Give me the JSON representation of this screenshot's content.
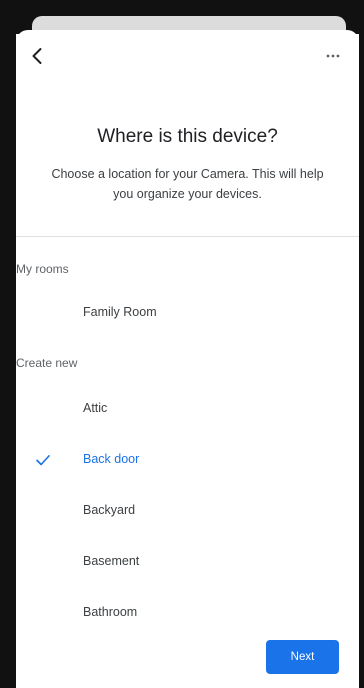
{
  "header": {
    "back_icon": "arrow-back-icon",
    "more_icon": "more-horizontal-icon",
    "more_label": "..."
  },
  "title": "Where is this device?",
  "subtitle": "Choose a location for your Camera. This will help you organize your devices.",
  "sections": {
    "my_rooms": {
      "label": "My rooms",
      "items": [
        {
          "label": "Family Room",
          "selected": false
        }
      ]
    },
    "create_new": {
      "label": "Create new",
      "items": [
        {
          "label": "Attic",
          "selected": false
        },
        {
          "label": "Back door",
          "selected": true
        },
        {
          "label": "Backyard",
          "selected": false
        },
        {
          "label": "Basement",
          "selected": false
        },
        {
          "label": "Bathroom",
          "selected": false
        }
      ]
    }
  },
  "footer": {
    "next_label": "Next"
  },
  "colors": {
    "accent": "#1a73e8",
    "text_primary": "#202124",
    "text_secondary": "#5f6368",
    "divider": "#e0e0e0"
  }
}
